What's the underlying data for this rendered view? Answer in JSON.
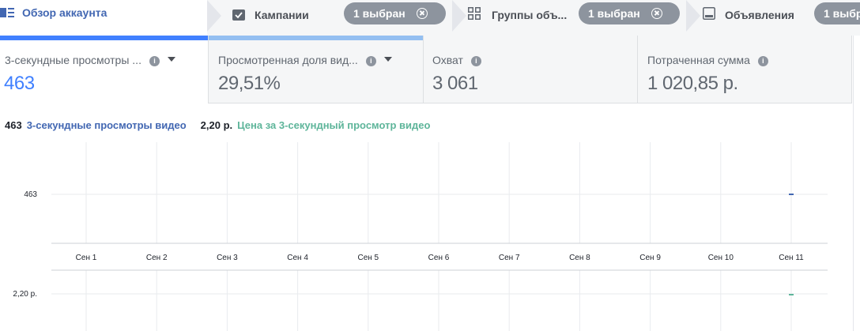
{
  "tabs": [
    {
      "label": "Обзор аккаунта",
      "active": true
    },
    {
      "label": "Кампании",
      "badge": "1 выбран"
    },
    {
      "label": "Группы объ...",
      "badge": "1 выбран"
    },
    {
      "label": "Объявления",
      "badge": "1 выбр"
    }
  ],
  "metrics": [
    {
      "title": "3-секундные просмотры ...",
      "value": "463",
      "has_dropdown": true,
      "bar_color": "#4080ff"
    },
    {
      "title": "Просмотренная доля вид...",
      "value": "29,51%",
      "has_dropdown": true,
      "bar_color": "#94bff1"
    },
    {
      "title": "Охват",
      "value": "3 061",
      "has_dropdown": false
    },
    {
      "title": "Потраченная сумма",
      "value": "1 020,85 р.",
      "has_dropdown": false
    }
  ],
  "legend": {
    "series1_value": "463",
    "series1_label": "3-секундные просмотры видео",
    "series2_value": "2,20 р.",
    "series2_label": "Цена за 3-секундный просмотр видео"
  },
  "colors": {
    "series1": "#4267b2",
    "series2": "#5eb59a",
    "accent": "#4080ff"
  },
  "chart_data": [
    {
      "type": "line",
      "categories": [
        "Сен 1",
        "Сен 2",
        "Сен 3",
        "Сен 4",
        "Сен 5",
        "Сен 6",
        "Сен 7",
        "Сен 8",
        "Сен 9",
        "Сен 10",
        "Сен 11"
      ],
      "series": [
        {
          "name": "3-секундные просмотры видео",
          "values": [
            null,
            null,
            null,
            null,
            null,
            null,
            null,
            null,
            null,
            null,
            463
          ]
        }
      ],
      "yticks": [
        "463"
      ],
      "grid": true
    },
    {
      "type": "line",
      "categories": [
        "Сен 1",
        "Сен 2",
        "Сен 3",
        "Сен 4",
        "Сен 5",
        "Сен 6",
        "Сен 7",
        "Сен 8",
        "Сен 9",
        "Сен 10",
        "Сен 11"
      ],
      "series": [
        {
          "name": "Цена за 3-секундный просмотр видео",
          "values": [
            null,
            null,
            null,
            null,
            null,
            null,
            null,
            null,
            null,
            null,
            2.2
          ]
        }
      ],
      "yticks": [
        "2,20 р."
      ],
      "grid": true
    }
  ]
}
